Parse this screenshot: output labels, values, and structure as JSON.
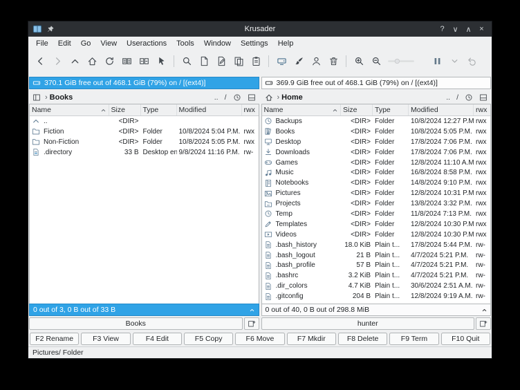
{
  "window": {
    "title": "Krusader"
  },
  "colors": {
    "accent": "#30a3e6",
    "titlebar_bg": "#2c2f33",
    "window_bg": "#eff0f1"
  },
  "titlebar": {
    "help": "?",
    "minimize": "∨",
    "maximize": "∧",
    "close": "×"
  },
  "menu": {
    "items": [
      "File",
      "Edit",
      "Go",
      "View",
      "Useractions",
      "Tools",
      "Window",
      "Settings",
      "Help"
    ]
  },
  "toolbar": {
    "items": [
      "back",
      "~forward",
      "up",
      "home",
      "refresh",
      "compare-directories",
      "sync-directories",
      "pointer",
      "|",
      "search",
      "view-file",
      "edit-file",
      "copy",
      "paste",
      "|",
      "device-menu",
      "brush",
      "user",
      "trash",
      "|",
      "zoom-in",
      "zoom-out",
      "~slider",
      "pause",
      "~chevron-down",
      "~undo"
    ]
  },
  "crumb": {
    "up": "..",
    "root": "/",
    "chevron": "›"
  },
  "left_panel": {
    "media_info": "370.1 GiB free out of 468.1 GiB (79%) on / [(ext4)]",
    "path": "Books",
    "columns": [
      "Name",
      "Size",
      "Type",
      "Modified",
      "rwx"
    ],
    "files": [
      {
        "icon": "up",
        "name": "..",
        "size": "<DIR>",
        "type": "",
        "modified": "",
        "perm": ""
      },
      {
        "icon": "folder",
        "name": "Fiction",
        "size": "<DIR>",
        "type": "Folder",
        "modified": "10/8/2024 5:04 P.M.",
        "perm": "rwx"
      },
      {
        "icon": "folder",
        "name": "Non-Fiction",
        "size": "<DIR>",
        "type": "Folder",
        "modified": "10/8/2024 5:05 P.M.",
        "perm": "rwx"
      },
      {
        "icon": "desktop-file",
        "name": ".directory",
        "size": "33 B",
        "type": "Desktop en...",
        "modified": "9/8/2024 11:16 P.M.",
        "perm": "rw-"
      }
    ],
    "status": "0 out of 3, 0 B out of 33 B",
    "tab": "Books"
  },
  "right_panel": {
    "media_info": "369.9 GiB free out of 468.1 GiB (79%) on / [(ext4)]",
    "path": "Home",
    "columns": [
      "Name",
      "Size",
      "Type",
      "Modified",
      "rwx"
    ],
    "files": [
      {
        "icon": "clock",
        "name": "Backups",
        "size": "<DIR>",
        "type": "Folder",
        "modified": "10/8/2024 12:27 P.M.",
        "perm": "rwx"
      },
      {
        "icon": "books",
        "name": "Books",
        "size": "<DIR>",
        "type": "Folder",
        "modified": "10/8/2024 5:05 P.M.",
        "perm": "rwx"
      },
      {
        "icon": "desktop",
        "name": "Desktop",
        "size": "<DIR>",
        "type": "Folder",
        "modified": "17/8/2024 7:06 P.M.",
        "perm": "rwx"
      },
      {
        "icon": "download",
        "name": "Downloads",
        "size": "<DIR>",
        "type": "Folder",
        "modified": "17/8/2024 7:06 P.M.",
        "perm": "rwx"
      },
      {
        "icon": "games",
        "name": "Games",
        "size": "<DIR>",
        "type": "Folder",
        "modified": "12/8/2024 11:10 A.M.",
        "perm": "rwx"
      },
      {
        "icon": "music",
        "name": "Music",
        "size": "<DIR>",
        "type": "Folder",
        "modified": "16/8/2024 8:58 P.M.",
        "perm": "rwx"
      },
      {
        "icon": "notebook",
        "name": "Notebooks",
        "size": "<DIR>",
        "type": "Folder",
        "modified": "14/8/2024 9:10 P.M.",
        "perm": "rwx"
      },
      {
        "icon": "picture",
        "name": "Pictures",
        "size": "<DIR>",
        "type": "Folder",
        "modified": "12/8/2024 10:31 P.M.",
        "perm": "rwx"
      },
      {
        "icon": "project",
        "name": "Projects",
        "size": "<DIR>",
        "type": "Folder",
        "modified": "13/8/2024 3:32 P.M.",
        "perm": "rwx"
      },
      {
        "icon": "clock",
        "name": "Temp",
        "size": "<DIR>",
        "type": "Folder",
        "modified": "11/8/2024 7:13 P.M.",
        "perm": "rwx"
      },
      {
        "icon": "template",
        "name": "Templates",
        "size": "<DIR>",
        "type": "Folder",
        "modified": "12/8/2024 10:30 P.M.",
        "perm": "rwx"
      },
      {
        "icon": "video",
        "name": "Videos",
        "size": "<DIR>",
        "type": "Folder",
        "modified": "12/8/2024 10:30 P.M.",
        "perm": "rwx"
      },
      {
        "icon": "file",
        "name": ".bash_history",
        "size": "18.0 KiB",
        "type": "Plain t...",
        "modified": "17/8/2024 5:44 P.M.",
        "perm": "rw-"
      },
      {
        "icon": "file",
        "name": ".bash_logout",
        "size": "21 B",
        "type": "Plain t...",
        "modified": "4/7/2024 5:21 P.M.",
        "perm": "rw-"
      },
      {
        "icon": "file",
        "name": ".bash_profile",
        "size": "57 B",
        "type": "Plain t...",
        "modified": "4/7/2024 5:21 P.M.",
        "perm": "rw-"
      },
      {
        "icon": "file",
        "name": ".bashrc",
        "size": "3.2 KiB",
        "type": "Plain t...",
        "modified": "4/7/2024 5:21 P.M.",
        "perm": "rw-"
      },
      {
        "icon": "file",
        "name": ".dir_colors",
        "size": "4.7 KiB",
        "type": "Plain t...",
        "modified": "30/6/2024 2:51 A.M.",
        "perm": "rw-"
      },
      {
        "icon": "file",
        "name": ".gitconfig",
        "size": "204 B",
        "type": "Plain t...",
        "modified": "12/8/2024 9:19 A.M.",
        "perm": "rw-"
      }
    ],
    "status": "0 out of 40, 0 B out of 298.8 MiB",
    "tab": "hunter"
  },
  "fn_keys": [
    "F2 Rename",
    "F3 View",
    "F4 Edit",
    "F5 Copy",
    "F6 Move",
    "F7 Mkdir",
    "F8 Delete",
    "F9 Term",
    "F10 Quit"
  ],
  "statusbar": {
    "text": "Pictures/ Folder"
  }
}
